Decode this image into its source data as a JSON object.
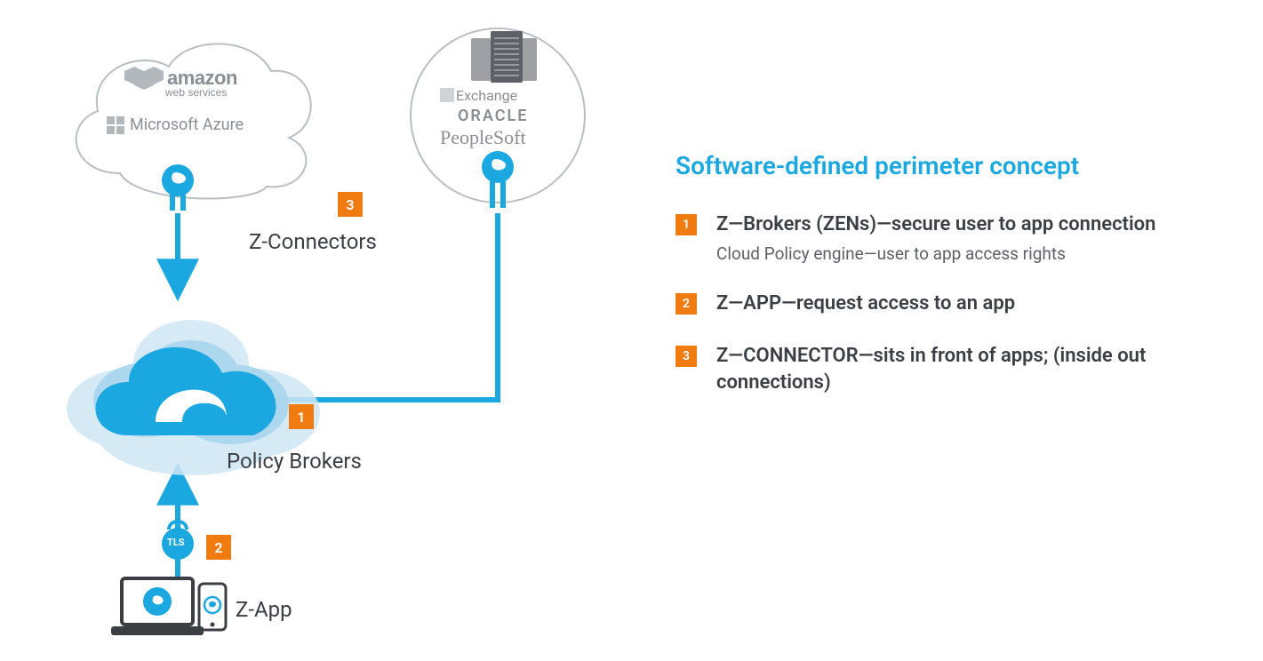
{
  "right": {
    "title": "Software-defined perimeter concept",
    "items": [
      {
        "n": "1",
        "title": "Z—Brokers (ZENs)—secure user to app connection",
        "sub": "Cloud Policy engine—user to app access rights"
      },
      {
        "n": "2",
        "title": "Z—APP—request access to an app",
        "sub": ""
      },
      {
        "n": "3",
        "title": "Z—CONNECTOR—sits in front of apps; (inside out connections)",
        "sub": ""
      }
    ]
  },
  "diagram": {
    "labels": {
      "zconnectors": "Z-Connectors",
      "policybrokers": "Policy Brokers",
      "zapp": "Z-App"
    },
    "badges": {
      "one": "1",
      "two": "2",
      "three": "3"
    },
    "cloud_left": {
      "aws_main": "amazon",
      "aws_sub": "web services",
      "azure": "Microsoft Azure"
    },
    "circle_right": {
      "exchange": "Exchange",
      "oracle": "ORACLE",
      "peoplesoft": "PeopleSoft"
    },
    "tls": "TLS"
  }
}
